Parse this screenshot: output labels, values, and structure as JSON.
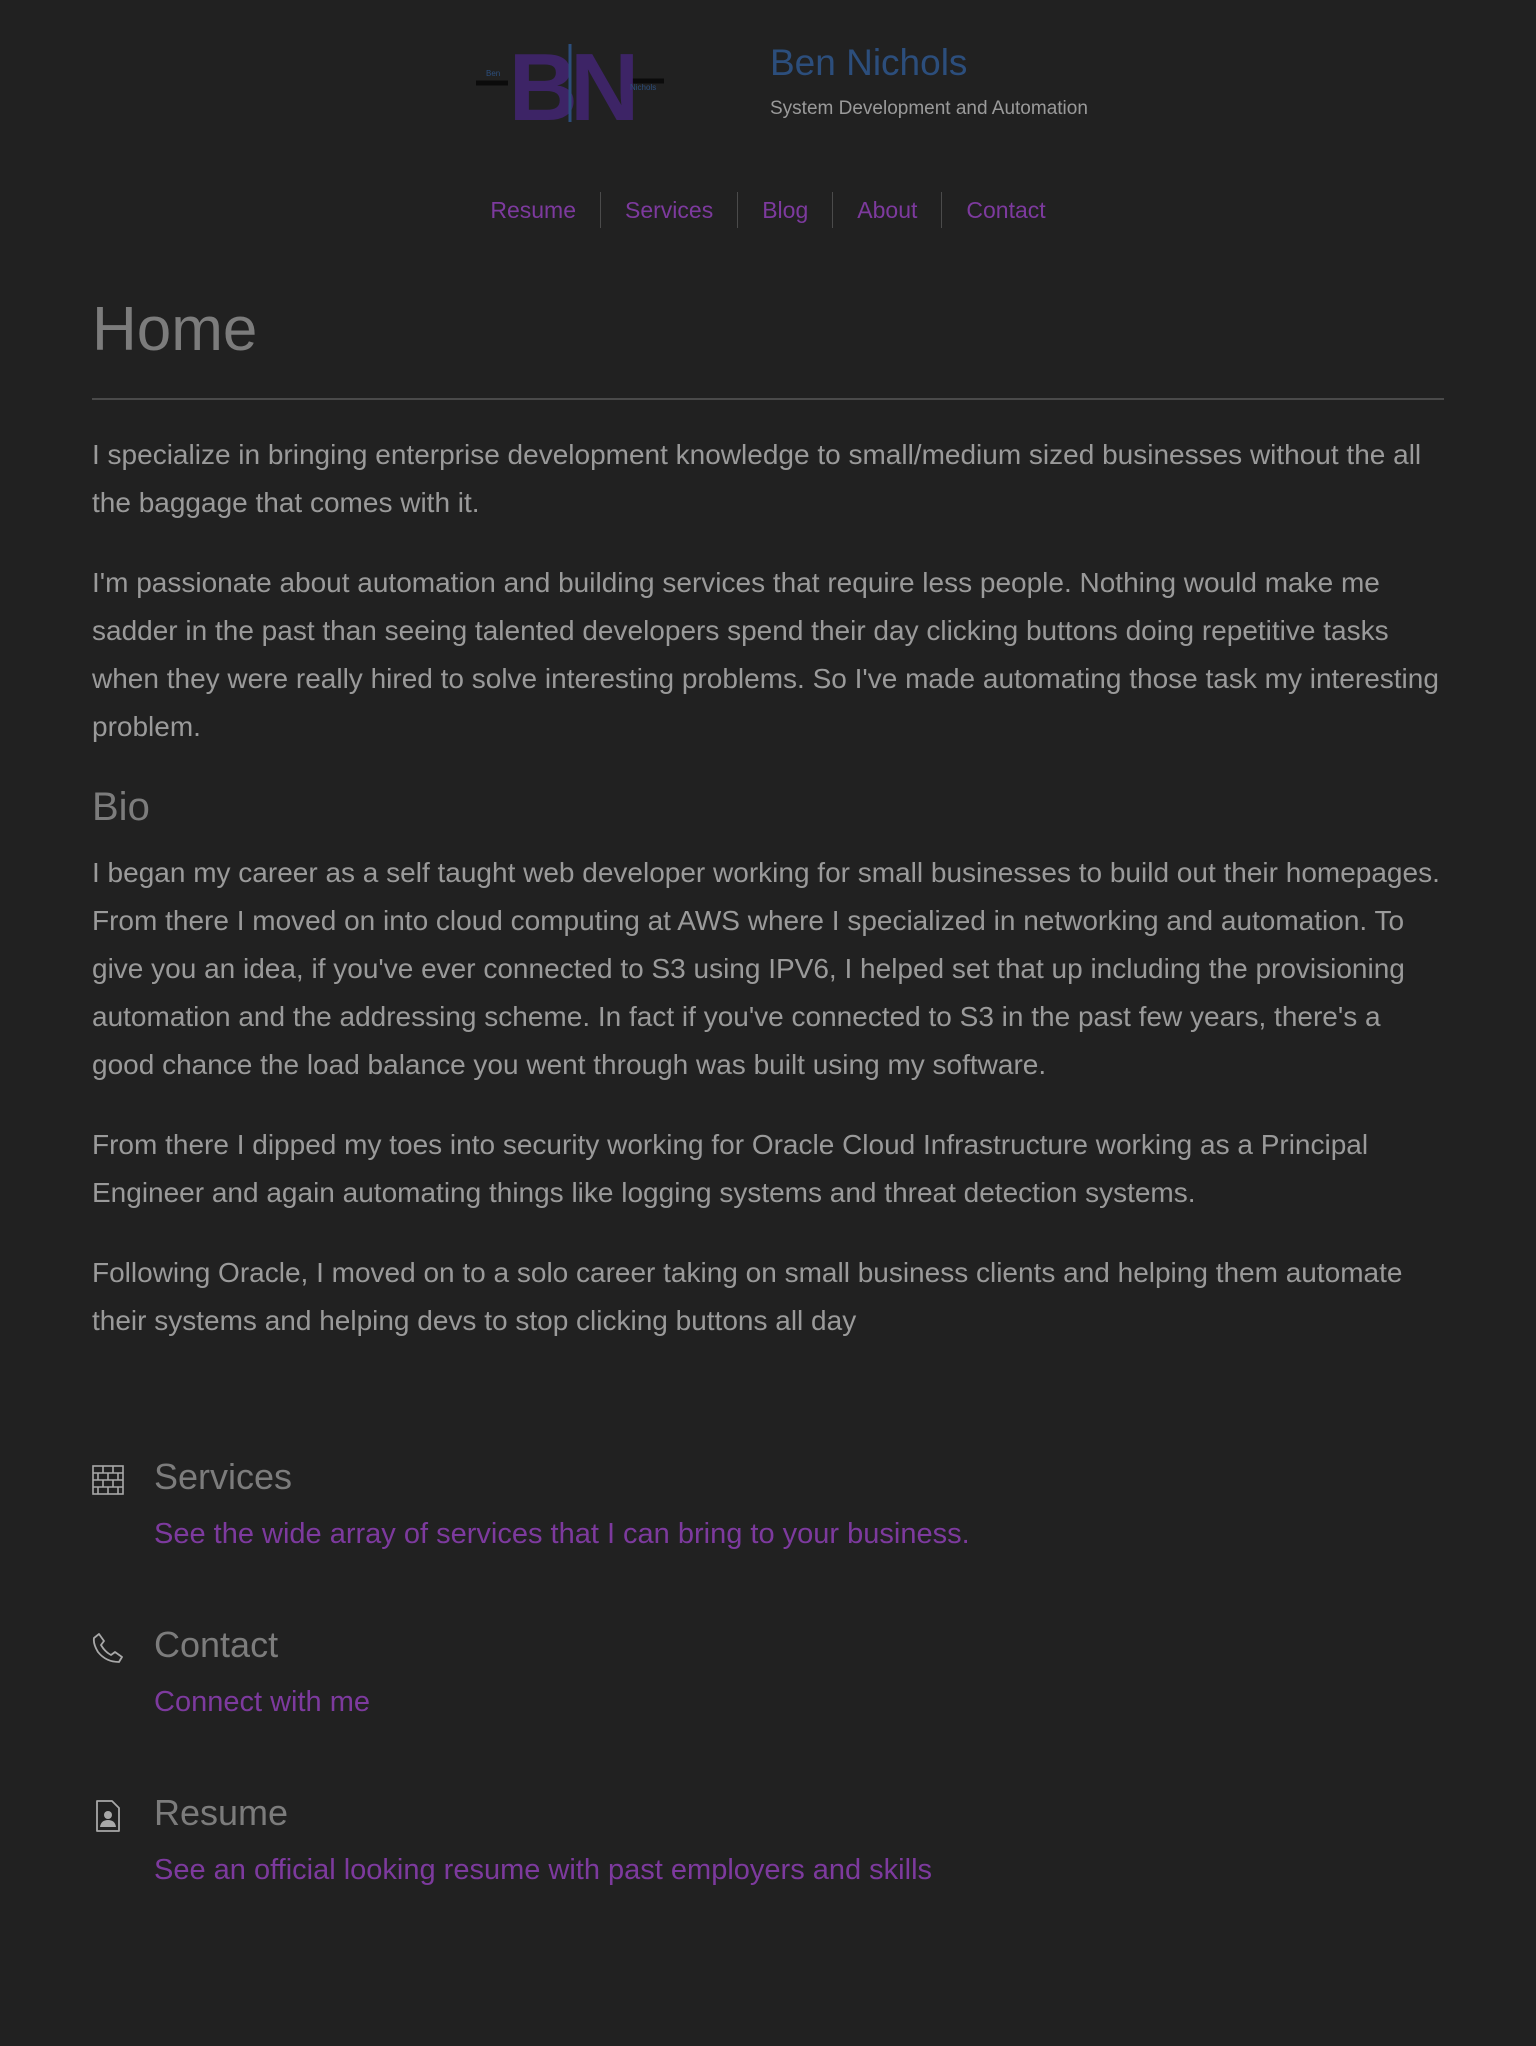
{
  "logo": {
    "letters": "BN",
    "small_left": "Ben",
    "small_right": "Nichols"
  },
  "header": {
    "name": "Ben Nichols",
    "tagline": "System Development and Automation"
  },
  "nav": {
    "items": [
      {
        "label": "Resume"
      },
      {
        "label": "Services"
      },
      {
        "label": "Blog"
      },
      {
        "label": "About"
      },
      {
        "label": "Contact"
      }
    ]
  },
  "main": {
    "title": "Home",
    "intro_paragraphs": [
      "I specialize in bringing enterprise development knowledge to small/medium sized businesses without the all the baggage that comes with it.",
      "I'm passionate about automation and building services that require less people. Nothing would make me sadder in the past than seeing talented developers spend their day clicking buttons doing repetitive tasks when they were really hired to solve interesting problems. So I've made automating those task my interesting problem."
    ],
    "bio_title": "Bio",
    "bio_paragraphs": [
      "I began my career as a self taught web developer working for small businesses to build out their homepages. From there I moved on into cloud computing at AWS where I specialized in networking and automation. To give you an idea, if you've ever connected to S3 using IPV6, I helped set that up including the provisioning automation and the addressing scheme. In fact if you've connected to S3 in the past few years, there's a good chance the load balance you went through was built using my software.",
      "From there I dipped my toes into security working for Oracle Cloud Infrastructure working as a Principal Engineer and again automating things like logging systems and threat detection systems.",
      "Following Oracle, I moved on to a solo career taking on small business clients and helping them automate their systems and helping devs to stop clicking buttons all day"
    ]
  },
  "features": [
    {
      "icon": "brick-wall-icon",
      "title": "Services",
      "link": "See the wide array of services that I can bring to your business."
    },
    {
      "icon": "phone-icon",
      "title": "Contact",
      "link": "Connect with me"
    },
    {
      "icon": "resume-document-icon",
      "title": "Resume",
      "link": "See an official looking resume with past employers and skills"
    }
  ],
  "colors": {
    "background": "#212121",
    "accent": "#7d3a9e",
    "name_blue": "#2c4e7c",
    "logo_purple": "#3d2466",
    "text": "#9a9a9a",
    "heading": "#7c7c7c"
  }
}
